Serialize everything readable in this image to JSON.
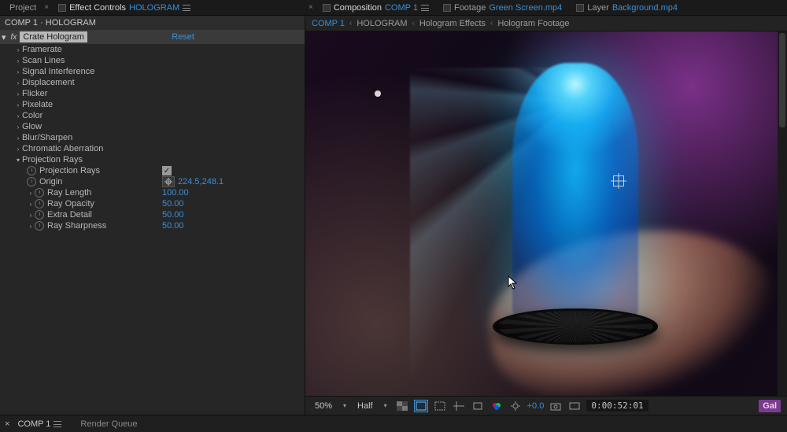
{
  "left_tabs": {
    "project": "Project",
    "effect_controls_prefix": "Effect Controls",
    "effect_controls_target": "HOLOGRAM"
  },
  "right_tabs": {
    "composition_prefix": "Composition",
    "composition_target": "COMP 1",
    "footage_prefix": "Footage",
    "footage_target": "Green Screen.mp4",
    "layer_prefix": "Layer",
    "layer_target": "Background.mp4"
  },
  "breadcrumb": {
    "items": [
      "COMP 1",
      "HOLOGRAM",
      "Hologram Effects",
      "Hologram Footage"
    ]
  },
  "ec": {
    "comp_layer": "COMP 1 · HOLOGRAM",
    "effect_name": "Crate Hologram",
    "reset": "Reset",
    "groups": {
      "framerate": "Framerate",
      "scan_lines": "Scan Lines",
      "signal_interference": "Signal Interference",
      "displacement": "Displacement",
      "flicker": "Flicker",
      "pixelate": "Pixelate",
      "color": "Color",
      "glow": "Glow",
      "blur_sharpen": "Blur/Sharpen",
      "chromatic_aberration": "Chromatic Aberration",
      "projection_rays": "Projection Rays"
    },
    "rays": {
      "checkbox_label": "Projection Rays",
      "origin_label": "Origin",
      "origin_value": "224.5,248.1",
      "ray_length_label": "Ray Length",
      "ray_length_value": "100.00",
      "ray_opacity_label": "Ray Opacity",
      "ray_opacity_value": "50.00",
      "extra_detail_label": "Extra Detail",
      "extra_detail_value": "50.00",
      "ray_sharpness_label": "Ray Sharpness",
      "ray_sharpness_value": "50.00"
    }
  },
  "viewer_foot": {
    "zoom": "50%",
    "resolution": "Half",
    "exposure": "+0.0",
    "timecode": "0:00:52:01"
  },
  "bottom": {
    "timeline_tab": "COMP 1",
    "render_queue": "Render Queue"
  },
  "badge": "Gal"
}
